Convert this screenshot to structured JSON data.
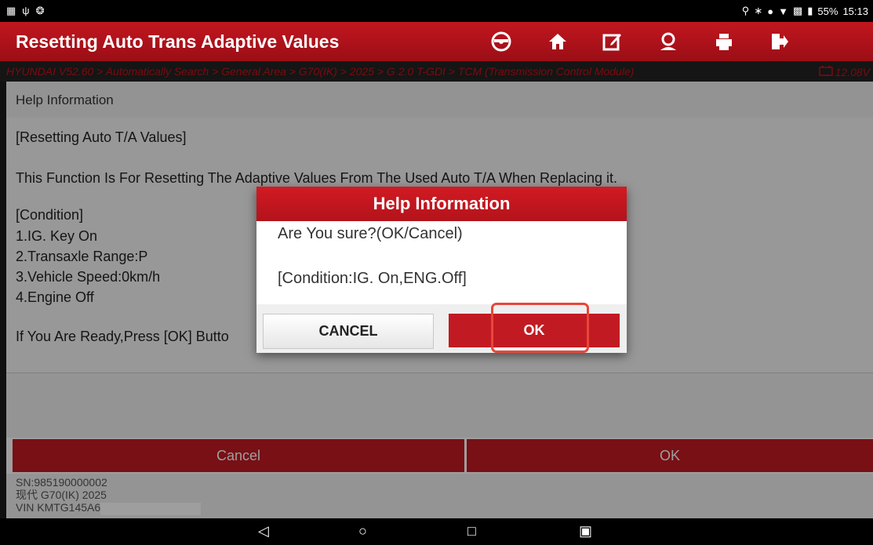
{
  "status_bar": {
    "left_icons": [
      "notification-icon",
      "vehicle-icon",
      "diag-icon"
    ],
    "battery_percent": "55%",
    "time": "15:13"
  },
  "header": {
    "title": "Resetting Auto Trans Adaptive Values",
    "toolbar_icons": [
      "steering-wheel-icon",
      "home-icon",
      "edit-report-icon",
      "feedback-icon",
      "print-icon",
      "exit-icon"
    ]
  },
  "breadcrumb": {
    "path": "HYUNDAI V52.60 > Automatically Search > General Area > G70(IK) > 2025 > G 2.0 T-GDI > TCM (Transmission Control Module)",
    "voltage": "12.08V"
  },
  "help_panel": {
    "header": "Help Information",
    "title_line": "[Resetting Auto T/A Values]",
    "description": "This Function Is For Resetting The Adaptive Values From The Used Auto T/A When Replacing it.",
    "condition_header": "[Condition]",
    "conditions": [
      "1.IG. Key On",
      "2.Transaxle Range:P",
      "3.Vehicle Speed:0km/h",
      "4.Engine Off"
    ],
    "ready_line": "If You Are Ready,Press [OK] Butto"
  },
  "bottom_buttons": {
    "cancel": "Cancel",
    "ok": "OK"
  },
  "device_info": {
    "sn": "SN:985190000002",
    "model": "现代 G70(IK) 2025",
    "vin": "VIN KMTG145A6"
  },
  "dialog": {
    "title": "Help Information",
    "line1": "Are You sure?(OK/Cancel)",
    "line2": "[Condition:IG. On,ENG.Off]",
    "cancel": "CANCEL",
    "ok": "OK"
  },
  "colors": {
    "brand_red": "#c21a22",
    "breadcrumb_red": "#c3131a",
    "highlight": "#e8463a"
  }
}
